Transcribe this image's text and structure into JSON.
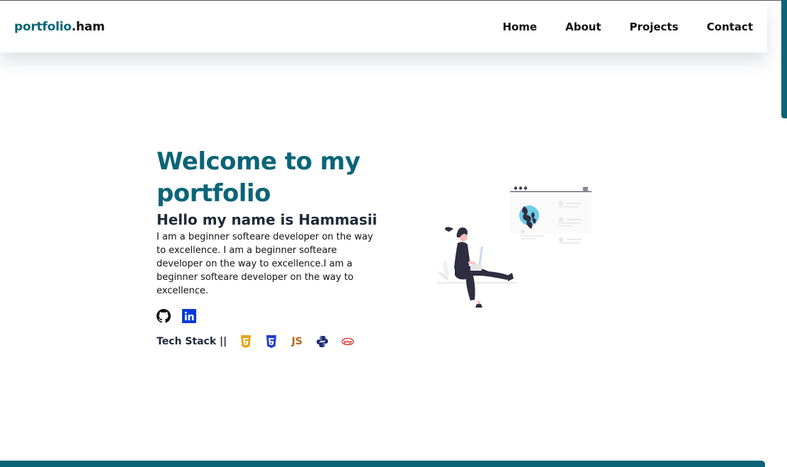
{
  "nav": {
    "logo_accent": "portfolio",
    "logo_rest": ".ham",
    "links": [
      "Home",
      "About",
      "Projects",
      "Contact"
    ]
  },
  "hero": {
    "title": "Welcome to my portfolio",
    "subtitle": "Hello my name is Hammasii",
    "description": "I am a beginner softeare developer on the way to excellence. I am a beginner softeare developer on the way to excellence.I am a beginner softeare developer on the way to excellence."
  },
  "socials": [
    {
      "name": "github-icon"
    },
    {
      "name": "linkedin-icon"
    }
  ],
  "tech_stack": {
    "label": "Tech Stack ||",
    "js_label": "JS",
    "icons": [
      "html5-icon",
      "css3-icon",
      "javascript-icon",
      "python-icon",
      "php-icon"
    ]
  },
  "colors": {
    "accent": "#0b6477",
    "text_dark": "#1f2a37",
    "html": "#e8a317",
    "css": "#1f3bd6",
    "js": "#b5651d",
    "python": "#1a2a7a",
    "php": "#cc1f1f",
    "linkedin": "#0a3ad6"
  }
}
